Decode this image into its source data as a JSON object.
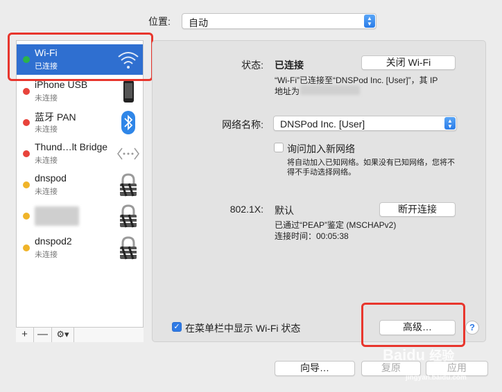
{
  "location": {
    "label": "位置:",
    "value": "自动"
  },
  "services": [
    {
      "name": "Wi-Fi",
      "status": "已连接",
      "dot": "#2bb34a",
      "icon": "wifi-icon",
      "selected": true
    },
    {
      "name": "iPhone USB",
      "status": "未连接",
      "dot": "#e8433b",
      "icon": "iphone-icon"
    },
    {
      "name": "蓝牙 PAN",
      "status": "未连接",
      "dot": "#e8433b",
      "icon": "bluetooth-icon"
    },
    {
      "name": "Thund…lt Bridge",
      "status": "未连接",
      "dot": "#e8433b",
      "icon": "bridge-icon"
    },
    {
      "name": "dnspod",
      "status": "未连接",
      "dot": "#f0b429",
      "icon": "vpn-lock-icon"
    },
    {
      "name": "",
      "status": "",
      "dot": "#f0b429",
      "icon": "vpn-lock-icon"
    },
    {
      "name": "dnspod2",
      "status": "未连接",
      "dot": "#f0b429",
      "icon": "vpn-lock-icon"
    }
  ],
  "list_controls": {
    "add": "+",
    "remove": "—",
    "gear": "⚙▾"
  },
  "status": {
    "label": "状态:",
    "value": "已连接",
    "button": "关闭 Wi-Fi",
    "desc_line1": "“Wi-Fi”已连接至“DNSPod Inc. [User]”，其 IP",
    "desc_line2": "地址为"
  },
  "network_name": {
    "label": "网络名称:",
    "value": "DNSPod Inc. [User]",
    "ask_label": "询问加入新网络",
    "ask_desc_line1": "将自动加入已知网络。如果没有已知网络，您将不",
    "ask_desc_line2": "得不手动选择网络。"
  },
  "security": {
    "label": "802.1X:",
    "value": "默认",
    "button": "断开连接",
    "auth_line": "已通过“PEAP”鉴定 (MSCHAPv2)",
    "time_line": "连接时间：00:05:38"
  },
  "show_status": {
    "label": "在菜单栏中显示 Wi-Fi 状态",
    "checked": true
  },
  "advanced_button": "高级…",
  "help": "?",
  "footer": {
    "assist": "向导…",
    "revert": "复原",
    "apply": "应用"
  },
  "watermark": {
    "brand": "Baidu",
    "sub": "经验",
    "url": "jingyan.baidu.com"
  },
  "highlight_color": "#e8362d",
  "accent": "#2f7ae5"
}
